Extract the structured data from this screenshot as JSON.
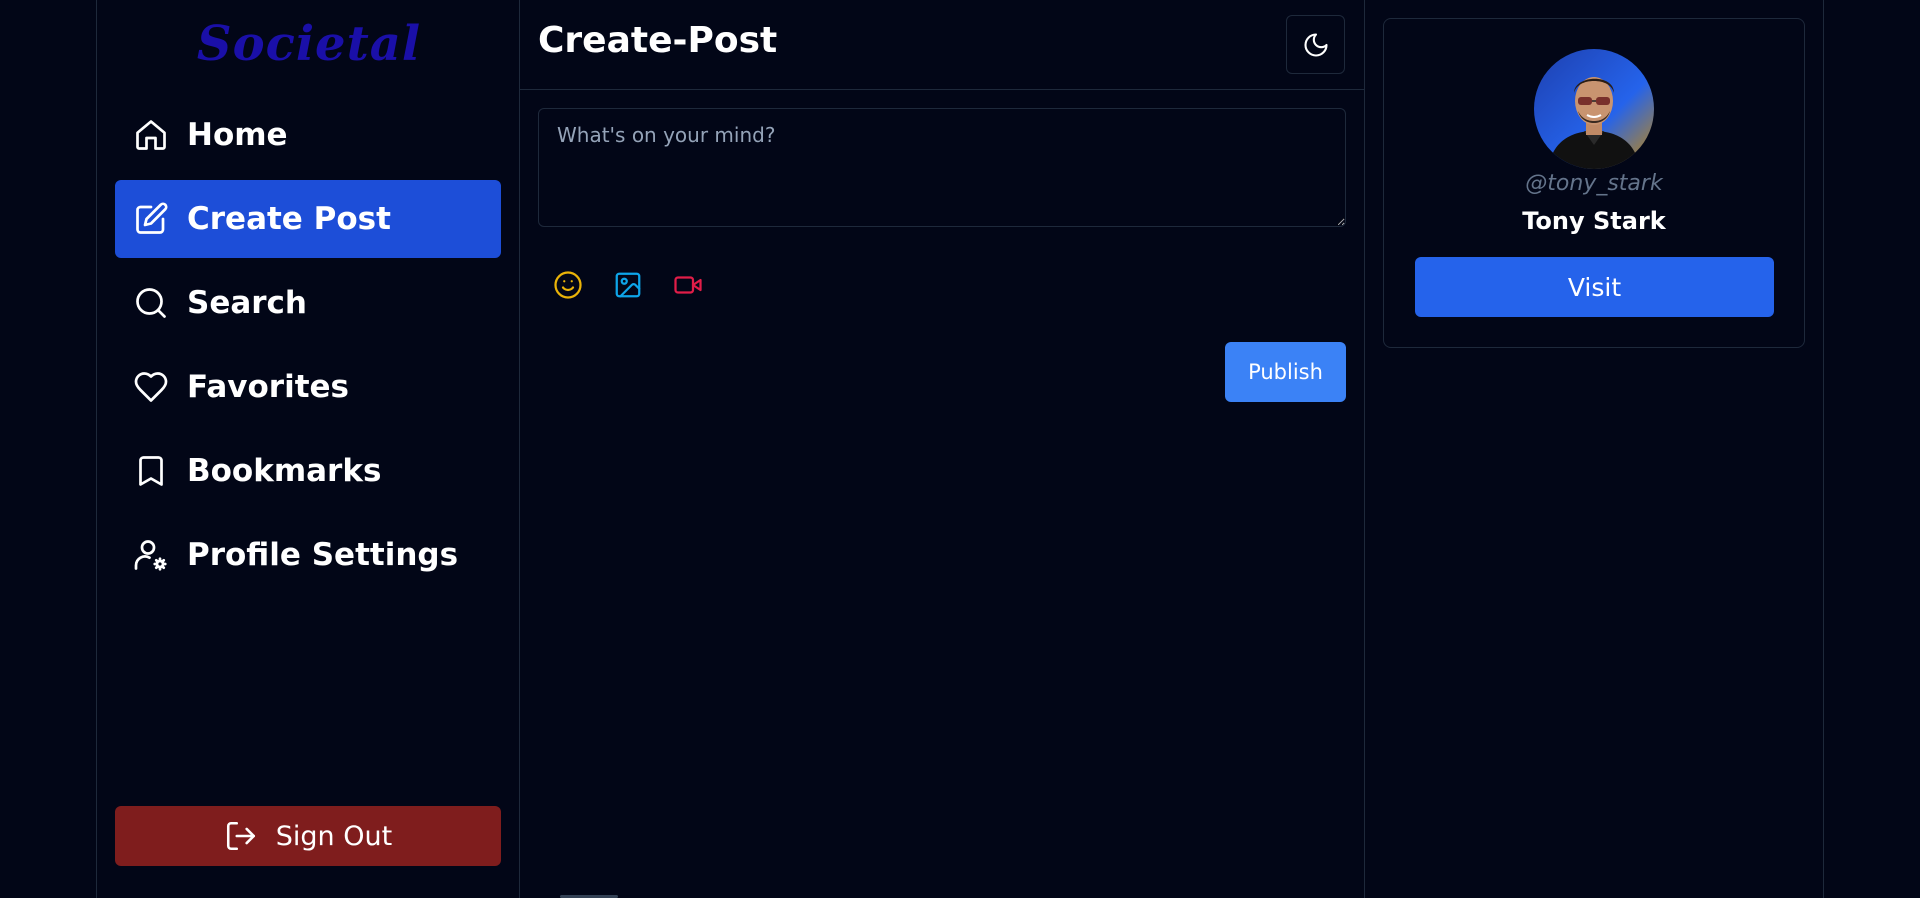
{
  "app": {
    "logo": "Societal"
  },
  "sidebar": {
    "items": [
      {
        "label": "Home",
        "icon": "home-icon",
        "active": false
      },
      {
        "label": "Create Post",
        "icon": "edit-icon",
        "active": true
      },
      {
        "label": "Search",
        "icon": "search-icon",
        "active": false
      },
      {
        "label": "Favorites",
        "icon": "heart-icon",
        "active": false
      },
      {
        "label": "Bookmarks",
        "icon": "bookmark-icon",
        "active": false
      },
      {
        "label": "Profile Settings",
        "icon": "user-gear-icon",
        "active": false
      }
    ],
    "signout": {
      "label": "Sign Out",
      "icon": "logout-icon"
    }
  },
  "main": {
    "title": "Create-Post",
    "theme_toggle_icon": "moon-icon",
    "composer": {
      "placeholder": "What's on your mind?",
      "value": "",
      "media_buttons": [
        {
          "icon": "emoji-icon",
          "color": "#eab308"
        },
        {
          "icon": "image-icon",
          "color": "#0ea5e9"
        },
        {
          "icon": "video-icon",
          "color": "#e11d48"
        }
      ]
    },
    "publish_label": "Publish"
  },
  "profile_card": {
    "handle": "@tony_stark",
    "name": "Tony Stark",
    "visit_label": "Visit"
  },
  "colors": {
    "background": "#020617",
    "logo": "#1a0fa8",
    "active_nav": "#1d4ed8",
    "signout": "#7f1d1d",
    "publish": "#3b82f6",
    "visit": "#2563eb",
    "border": "#1e293b"
  }
}
